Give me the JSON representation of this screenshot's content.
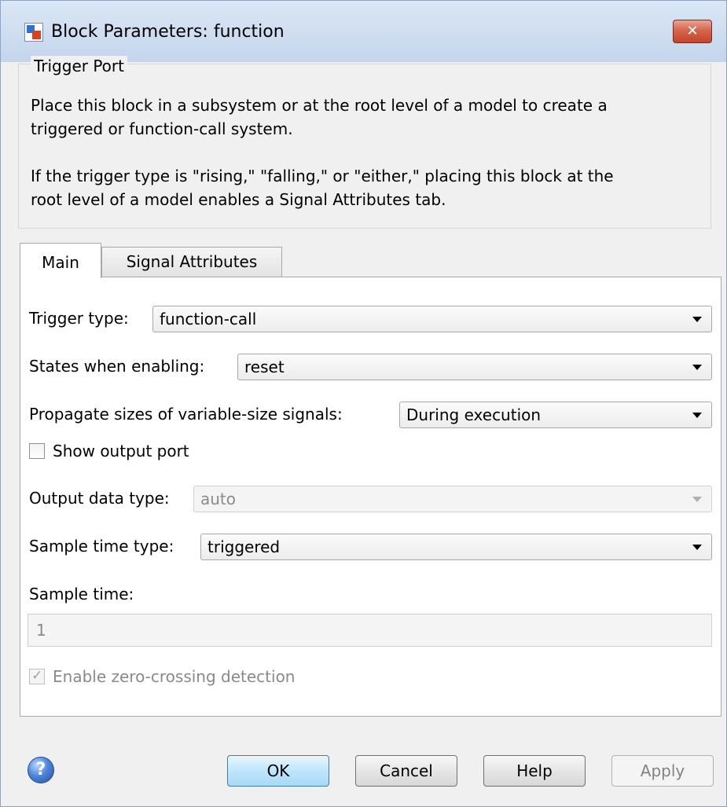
{
  "window": {
    "title": "Block Parameters: function",
    "close_symbol": "✕"
  },
  "description": {
    "group_title": "Trigger Port",
    "text": "Place this block in a subsystem or at the root level of a model to create a\ntriggered or function-call system.\n\nIf the trigger type is \"rising,\" \"falling,\" or \"either,\" placing this block at the\nroot level of a model enables a Signal Attributes tab."
  },
  "tabs": [
    {
      "label": "Main",
      "active": true
    },
    {
      "label": "Signal Attributes",
      "active": false
    }
  ],
  "main": {
    "trigger_type": {
      "label": "Trigger type:",
      "value": "function-call"
    },
    "states_when_enabling": {
      "label": "States when enabling:",
      "value": "reset"
    },
    "propagate_sizes": {
      "label": "Propagate sizes of variable-size signals:",
      "value": "During execution"
    },
    "show_output_port": {
      "label": "Show output port",
      "checked": false
    },
    "output_data_type": {
      "label": "Output data type:",
      "value": "auto",
      "enabled": false
    },
    "sample_time_type": {
      "label": "Sample time type:",
      "value": "triggered"
    },
    "sample_time": {
      "label": "Sample time:",
      "value": "1",
      "enabled": false
    },
    "zero_crossing": {
      "label": "Enable zero-crossing detection",
      "checked": true,
      "enabled": false
    }
  },
  "buttons": {
    "help_icon": "?",
    "ok": "OK",
    "cancel": "Cancel",
    "help": "Help",
    "apply": "Apply"
  },
  "icons": {
    "app": "simulink-block-icon",
    "close": "close-icon",
    "help": "help-icon",
    "dropdown": "chevron-down-icon",
    "checkbox": "checkbox-icon"
  }
}
